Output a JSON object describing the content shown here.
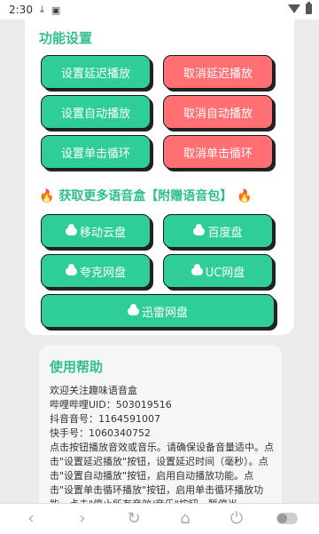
{
  "status_bar": {
    "time": "2:30"
  },
  "section_function": {
    "title": "功能设置"
  },
  "buttons": {
    "set_delay": "设置延迟播放",
    "cancel_delay": "取消延迟播放",
    "set_auto": "设置自动播放",
    "cancel_auto": "取消自动播放",
    "set_loop": "设置单击循环",
    "cancel_loop": "取消单击循环"
  },
  "promo": {
    "text": "获取更多语音盒【附赠语音包】"
  },
  "downloads": {
    "mobile_cloud": "移动云盘",
    "baidu": "百度盘",
    "quark": "夸克网盘",
    "uc": "UC网盘",
    "xunlei": "迅雷网盘"
  },
  "help": {
    "title": "使用帮助",
    "lines": [
      "欢迎关注趣味语音盒",
      "哔哩哔哩UID：503019516",
      "抖音音号：1164591007",
      "快手号：1060340752",
      "点击按钮播放音效或音乐。请确保设备音量适中。点击\"设置延迟播放\"按钮，设置延迟时间（毫秒）。点击\"设置自动播放\"按钮，启用自动播放功能。点击\"设置单击循环播放\"按钮，启用单击循环播放功能。点击\"停止所有音效/音乐\"按钮，暂停当"
    ]
  },
  "colors": {
    "accent": "#2fce98",
    "cancel": "#ff6f73",
    "title": "#2fbf8d"
  },
  "nav_icons": [
    "back-icon",
    "forward-icon",
    "reload-icon",
    "home-icon",
    "power-icon",
    "toggle-switch"
  ]
}
